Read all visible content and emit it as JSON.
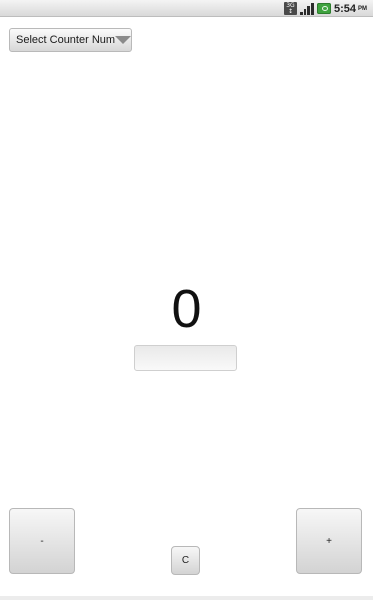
{
  "status_bar": {
    "network_label_top": "3G",
    "network_label_bottom": "↕",
    "time": "5:54",
    "ampm": "PM",
    "icons": [
      "network-3g-icon",
      "signal-icon",
      "battery-icon"
    ]
  },
  "spinner": {
    "label": "Select Counter Num"
  },
  "counter": {
    "value": "0",
    "input_value": ""
  },
  "buttons": {
    "minus_label": "-",
    "plus_label": "+",
    "clear_label": "C"
  }
}
